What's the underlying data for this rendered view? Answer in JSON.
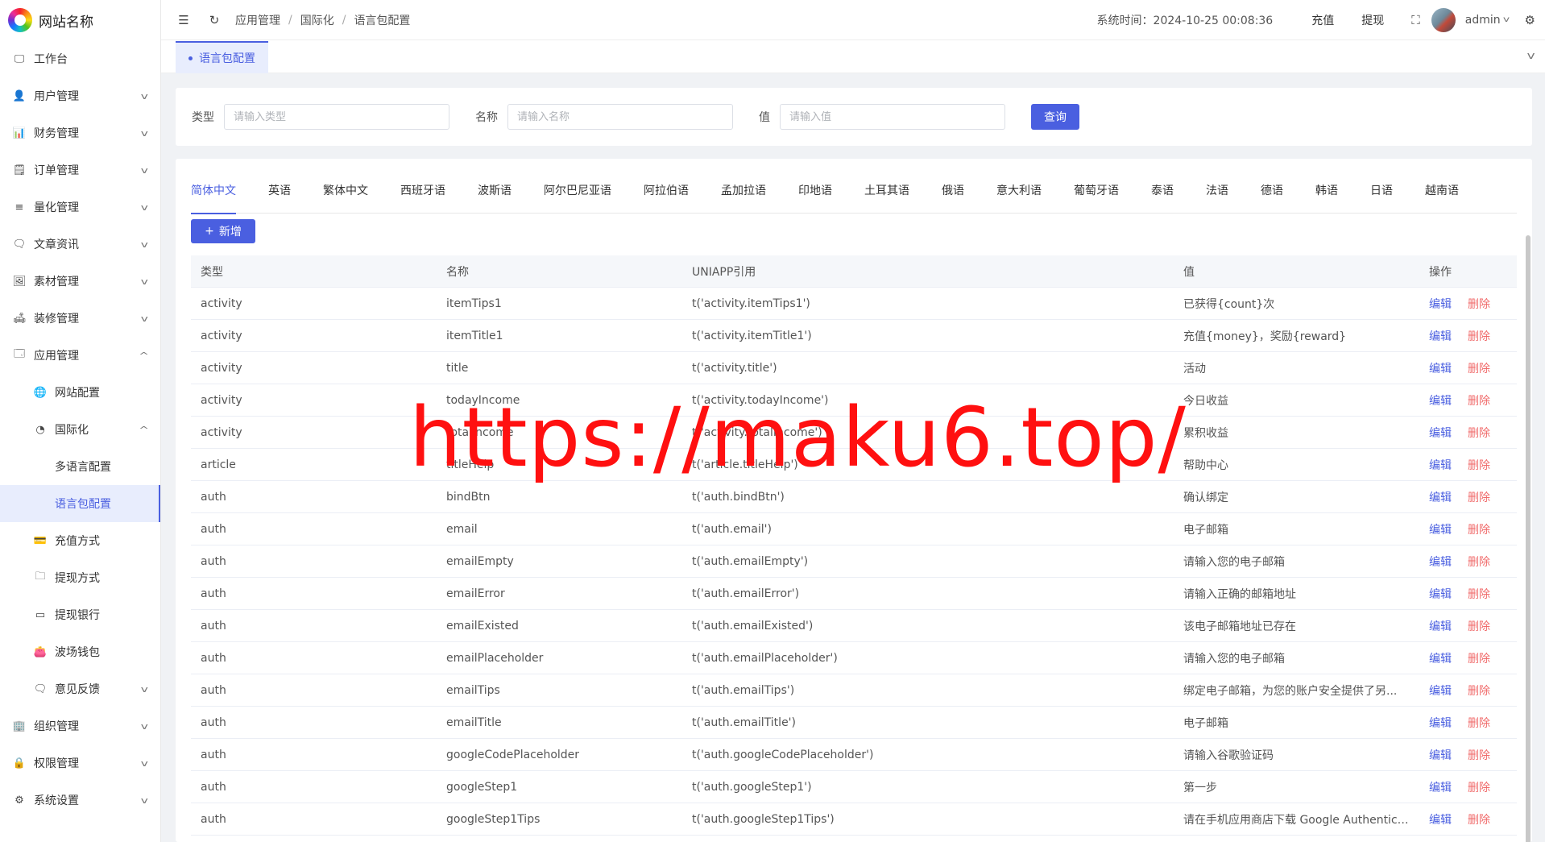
{
  "site": {
    "name": "网站名称"
  },
  "sidebar": {
    "items": [
      {
        "label": "工作台",
        "icon": "monitor-icon",
        "glyph": "🖵",
        "level": 0,
        "arrow": ""
      },
      {
        "label": "用户管理",
        "icon": "user-icon",
        "glyph": "👤",
        "level": 0,
        "arrow": "down"
      },
      {
        "label": "财务管理",
        "icon": "chart-icon",
        "glyph": "📊",
        "level": 0,
        "arrow": "down"
      },
      {
        "label": "订单管理",
        "icon": "order-icon",
        "glyph": "🗒",
        "level": 0,
        "arrow": "down"
      },
      {
        "label": "量化管理",
        "icon": "quant-icon",
        "glyph": "≡",
        "level": 0,
        "arrow": "down"
      },
      {
        "label": "文章资讯",
        "icon": "article-icon",
        "glyph": "🗨",
        "level": 0,
        "arrow": "down"
      },
      {
        "label": "素材管理",
        "icon": "image-icon",
        "glyph": "🖼",
        "level": 0,
        "arrow": "down"
      },
      {
        "label": "装修管理",
        "icon": "decor-icon",
        "glyph": "🛋",
        "level": 0,
        "arrow": "down"
      },
      {
        "label": "应用管理",
        "icon": "app-icon",
        "glyph": "🗔",
        "level": 0,
        "arrow": "up"
      },
      {
        "label": "网站配置",
        "icon": "globe-icon",
        "glyph": "🌐",
        "level": 1,
        "arrow": ""
      },
      {
        "label": "国际化",
        "icon": "i18n-icon",
        "glyph": "◔",
        "level": 1,
        "arrow": "up"
      },
      {
        "label": "多语言配置",
        "icon": "",
        "glyph": "",
        "level": 2,
        "arrow": ""
      },
      {
        "label": "语言包配置",
        "icon": "",
        "glyph": "",
        "level": 2,
        "arrow": "",
        "active": true
      },
      {
        "label": "充值方式",
        "icon": "recharge-icon",
        "glyph": "💳",
        "level": 1,
        "arrow": ""
      },
      {
        "label": "提现方式",
        "icon": "folder-icon",
        "glyph": "🗀",
        "level": 1,
        "arrow": ""
      },
      {
        "label": "提现银行",
        "icon": "card-icon",
        "glyph": "▭",
        "level": 1,
        "arrow": ""
      },
      {
        "label": "波场钱包",
        "icon": "wallet-icon",
        "glyph": "👛",
        "level": 1,
        "arrow": ""
      },
      {
        "label": "意见反馈",
        "icon": "feedback-icon",
        "glyph": "🗨",
        "level": 1,
        "arrow": "down"
      },
      {
        "label": "组织管理",
        "icon": "org-icon",
        "glyph": "🏢",
        "level": 0,
        "arrow": "down"
      },
      {
        "label": "权限管理",
        "icon": "lock-icon",
        "glyph": "🔒",
        "level": 0,
        "arrow": "down"
      },
      {
        "label": "系统设置",
        "icon": "gear-icon",
        "glyph": "⚙",
        "level": 0,
        "arrow": "down"
      }
    ]
  },
  "header": {
    "breadcrumb": [
      "应用管理",
      "国际化",
      "语言包配置"
    ],
    "system_time": "系统时间：2024-10-25 00:08:36",
    "recharge": "充值",
    "withdraw": "提现",
    "user": "admin"
  },
  "page_tab": {
    "label": "语言包配置"
  },
  "search": {
    "type_label": "类型",
    "type_placeholder": "请输入类型",
    "name_label": "名称",
    "name_placeholder": "请输入名称",
    "value_label": "值",
    "value_placeholder": "请输入值",
    "query_button": "查询"
  },
  "languages": [
    "简体中文",
    "英语",
    "繁体中文",
    "西班牙语",
    "波斯语",
    "阿尔巴尼亚语",
    "阿拉伯语",
    "孟加拉语",
    "印地语",
    "土耳其语",
    "俄语",
    "意大利语",
    "葡萄牙语",
    "泰语",
    "法语",
    "德语",
    "韩语",
    "日语",
    "越南语"
  ],
  "add_button": "新增",
  "table": {
    "headers": {
      "type": "类型",
      "name": "名称",
      "uniapp": "UNIAPP引用",
      "value": "值",
      "op": "操作"
    },
    "edit": "编辑",
    "delete": "删除",
    "rows": [
      {
        "type": "activity",
        "name": "itemTips1",
        "uniapp": "t('activity.itemTips1')",
        "value": "已获得{count}次"
      },
      {
        "type": "activity",
        "name": "itemTitle1",
        "uniapp": "t('activity.itemTitle1')",
        "value": "充值{money}，奖励{reward}"
      },
      {
        "type": "activity",
        "name": "title",
        "uniapp": "t('activity.title')",
        "value": "活动"
      },
      {
        "type": "activity",
        "name": "todayIncome",
        "uniapp": "t('activity.todayIncome')",
        "value": "今日收益"
      },
      {
        "type": "activity",
        "name": "totalIncome",
        "uniapp": "t('activity.totalIncome')",
        "value": "累积收益"
      },
      {
        "type": "article",
        "name": "titleHelp",
        "uniapp": "t('article.titleHelp')",
        "value": "帮助中心"
      },
      {
        "type": "auth",
        "name": "bindBtn",
        "uniapp": "t('auth.bindBtn')",
        "value": "确认绑定"
      },
      {
        "type": "auth",
        "name": "email",
        "uniapp": "t('auth.email')",
        "value": "电子邮箱"
      },
      {
        "type": "auth",
        "name": "emailEmpty",
        "uniapp": "t('auth.emailEmpty')",
        "value": "请输入您的电子邮箱"
      },
      {
        "type": "auth",
        "name": "emailError",
        "uniapp": "t('auth.emailError')",
        "value": "请输入正确的邮箱地址"
      },
      {
        "type": "auth",
        "name": "emailExisted",
        "uniapp": "t('auth.emailExisted')",
        "value": "该电子邮箱地址已存在"
      },
      {
        "type": "auth",
        "name": "emailPlaceholder",
        "uniapp": "t('auth.emailPlaceholder')",
        "value": "请输入您的电子邮箱"
      },
      {
        "type": "auth",
        "name": "emailTips",
        "uniapp": "t('auth.emailTips')",
        "value": "绑定电子邮箱，为您的账户安全提供了另..."
      },
      {
        "type": "auth",
        "name": "emailTitle",
        "uniapp": "t('auth.emailTitle')",
        "value": "电子邮箱"
      },
      {
        "type": "auth",
        "name": "googleCodePlaceholder",
        "uniapp": "t('auth.googleCodePlaceholder')",
        "value": "请输入谷歌验证码"
      },
      {
        "type": "auth",
        "name": "googleStep1",
        "uniapp": "t('auth.googleStep1')",
        "value": "第一步"
      },
      {
        "type": "auth",
        "name": "googleStep1Tips",
        "uniapp": "t('auth.googleStep1Tips')",
        "value": "请在手机应用商店下载 Google Authentica..."
      }
    ]
  },
  "watermark": "https://maku6.top/",
  "colors": {
    "accent": "#4a5fe0",
    "danger": "#f06a6a",
    "watermark": "#ff1010"
  }
}
